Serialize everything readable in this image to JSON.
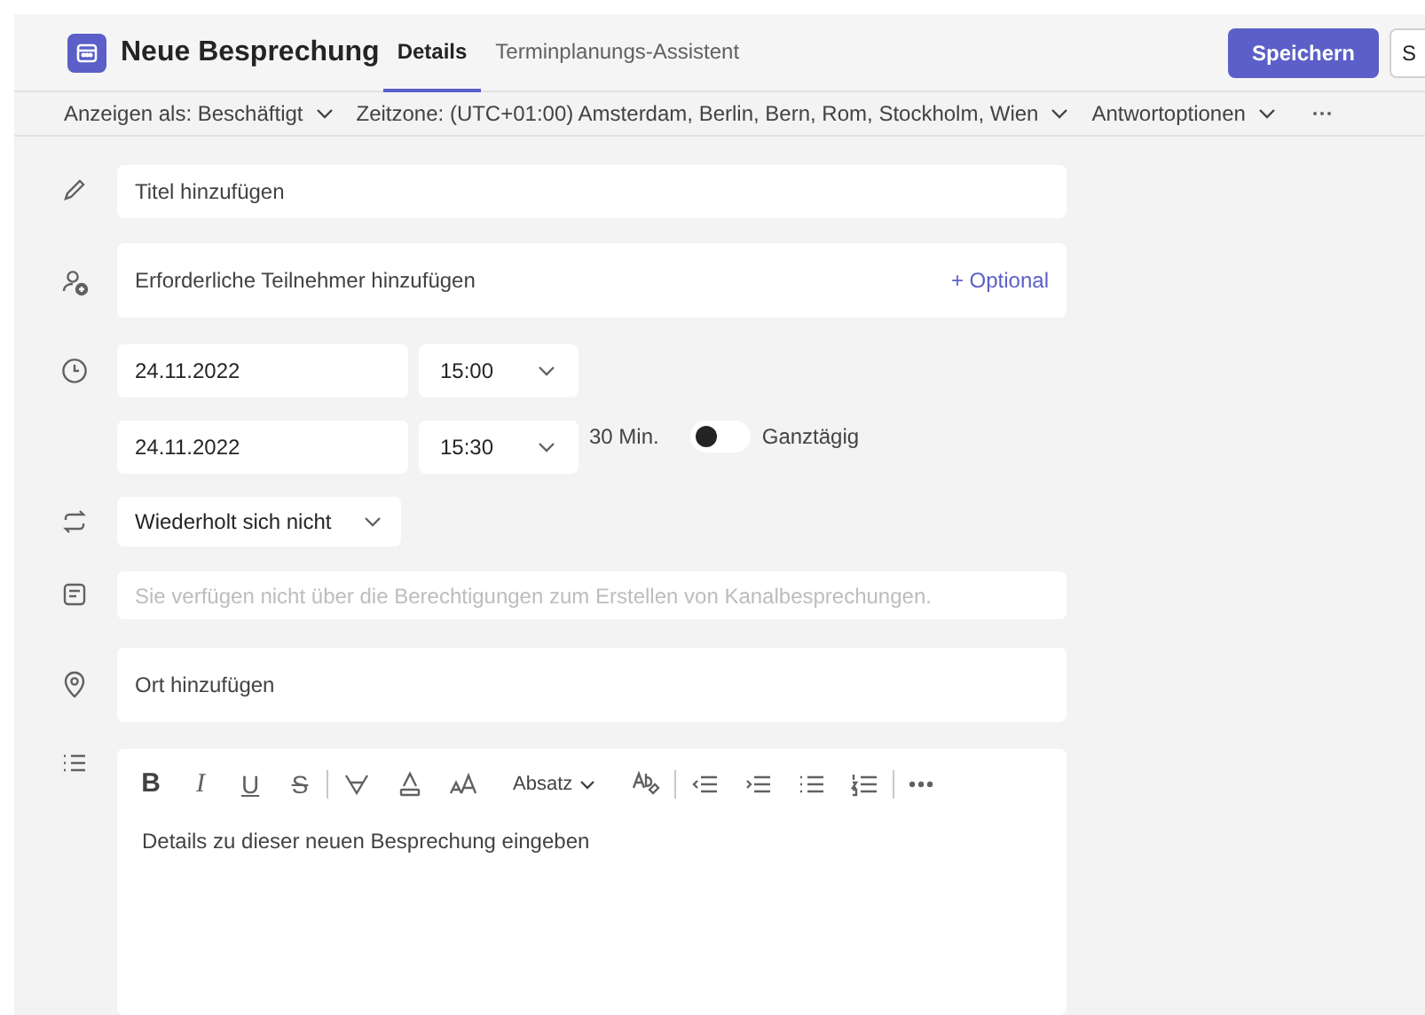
{
  "header": {
    "title": "Neue Besprechung",
    "tabs": [
      {
        "label": "Details",
        "selected": true
      },
      {
        "label": "Terminplanungs-Assistent",
        "selected": false
      }
    ],
    "save_button": "Speichern",
    "second_button": "S"
  },
  "toolbar": [
    {
      "label": "Anzeigen als: Beschäftigt"
    },
    {
      "label": "Zeitzone: (UTC+01:00) Amsterdam, Berlin, Bern, Rom, Stockholm, Wien"
    },
    {
      "label": "Antwortoptionen"
    }
  ],
  "title_field": {
    "placeholder": "Titel hinzufügen"
  },
  "attendees_field": {
    "placeholder": "Erforderliche Teilnehmer hinzufügen",
    "optional_link": "+ Optional"
  },
  "start": {
    "date": "24.11.2022",
    "time": "15:00"
  },
  "end": {
    "date": "24.11.2022",
    "time": "15:30",
    "duration": "30 Min.",
    "all_day": {
      "label": "Ganztägig",
      "on": false
    }
  },
  "repeat": {
    "value": "Wiederholt sich nicht"
  },
  "channel_field": {
    "placeholder": "Sie verfügen nicht über die Berechtigungen zum Erstellen von Kanalbesprechungen.",
    "disabled": true
  },
  "location_field": {
    "placeholder": "Ort hinzufügen"
  },
  "editor": {
    "format_buttons": [
      {
        "kind": "bold",
        "label": "B"
      },
      {
        "kind": "italic",
        "label": "I"
      },
      {
        "kind": "underline",
        "label": "U"
      },
      {
        "kind": "strike",
        "label": "S"
      }
    ],
    "paragraph": "Absatz",
    "placeholder": "Details zu dieser neuen Besprechung eingeben"
  }
}
